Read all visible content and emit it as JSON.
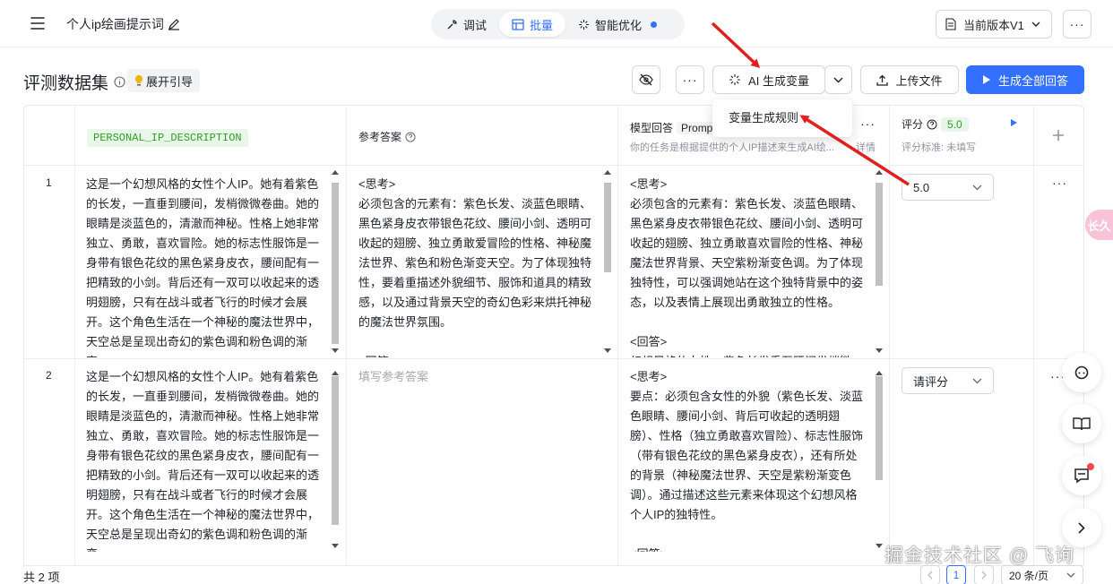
{
  "header": {
    "doc_title": "个人ip绘画提示词",
    "tabs": [
      {
        "label": "调试",
        "icon": "wrench-icon"
      },
      {
        "label": "批量",
        "icon": "grid-icon",
        "active": true
      },
      {
        "label": "智能优化",
        "icon": "sparkle-icon",
        "dot": true
      }
    ],
    "version_label": "当前版本V1"
  },
  "section": {
    "title": "评测数据集",
    "guide_label": "展开引导",
    "ai_generate_label": "AI 生成变量",
    "upload_label": "上传文件",
    "generate_all_label": "生成全部回答",
    "dropdown_item": "变量生成规则"
  },
  "table": {
    "columns": {
      "variable": "PERSONAL_IP_DESCRIPTION",
      "reference": "参考答案",
      "model_answer": "模型回答",
      "model_tag": "Promp",
      "model_sub": "你的任务是根据提供的个人IP描述来生成AI绘...",
      "details_link": "详情",
      "score": "评分",
      "score_value": "5.0",
      "score_standard": "评分标准: 未填写"
    },
    "rows": [
      {
        "index": "1",
        "description": "这是一个幻想风格的女性个人IP。她有着紫色的长发，一直垂到腰间，发梢微微卷曲。她的眼睛是淡蓝色的，清澈而神秘。性格上她非常独立、勇敢，喜欢冒险。她的标志性服饰是一身带有银色花纹的黑色紧身皮衣，腰间配有一把精致的小剑。背后还有一双可以收起来的透明翅膀，只有在战斗或者飞行的时候才会展开。这个角色生活在一个神秘的魔法世界中，天空总是呈现出奇幻的紫色调和粉色调的渐变。",
        "reference": "<思考>\n必须包含的元素有：紫色长发、淡蓝色眼睛、黑色紧身皮衣带银色花纹、腰间小剑、透明可收起的翅膀、独立勇敢爱冒险的性格、神秘魔法世界、紫色和粉色渐变天空。为了体现独特性，要着重描述外貌细节、服饰和道具的精致感，以及通过背景天空的奇幻色彩来烘托神秘的魔法世界氛围。\n\n<回答>",
        "reference_placeholder": "",
        "model_answer": "<思考>\n必须包含的元素有：紫色长发、淡蓝色眼睛、黑色紧身皮衣带银色花纹、腰间小剑、透明可收起的翅膀、独立勇敢喜欢冒险的性格、神秘魔法世界背景、天空紫粉渐变色调。为了体现独特性，可以强调她站在这个独特背景中的姿态，以及表情上展现出勇敢独立的性格。\n\n<回答>\n幻想风格的女性，紫色长发垂至腰间发梢微",
        "score": "5.0"
      },
      {
        "index": "2",
        "description": "这是一个幻想风格的女性个人IP。她有着紫色的长发，一直垂到腰间，发梢微微卷曲。她的眼睛是淡蓝色的，清澈而神秘。性格上她非常独立、勇敢，喜欢冒险。她的标志性服饰是一身带有银色花纹的黑色紧身皮衣，腰间配有一把精致的小剑。背后还有一双可以收起来的透明翅膀，只有在战斗或者飞行的时候才会展开。这个角色生活在一个神秘的魔法世界中，天空总是呈现出奇幻的紫色调和粉色调的渐变。",
        "reference": "",
        "reference_placeholder": "填写参考答案",
        "model_answer": "<思考>\n要点：必须包含女性的外貌（紫色长发、淡蓝色眼睛、腰间小剑、背后可收起的透明翅膀）、性格（独立勇敢喜欢冒险）、标志性服饰（带有银色花纹的黑色紧身皮衣），还有所处的背景（神秘魔法世界、天空是紫粉渐变色调）。通过描述这些元素来体现这个幻想风格个人IP的独特性。\n\n<回答>",
        "score": "请评分"
      }
    ]
  },
  "footer": {
    "total": "共 2 项",
    "page": "1",
    "page_size": "20 条/页"
  },
  "watermark": "掘金技术社区 @ 飞询",
  "side_tab": "长久",
  "colors": {
    "accent": "#3370ff",
    "green": "#2ea121",
    "arrow": "#e02020"
  }
}
